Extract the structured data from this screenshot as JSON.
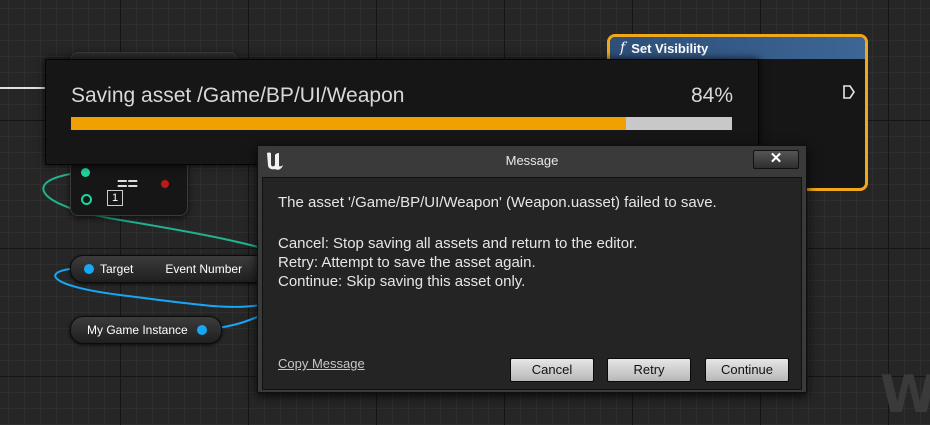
{
  "progress": {
    "label": "Saving asset /Game/BP/UI/Weapon",
    "percent_text": "84%",
    "fraction": 0.84,
    "bar_color": "#f0a000"
  },
  "nodes": {
    "set_visibility_title": "Set Visibility",
    "function_glyph": "f",
    "compare_op": "==",
    "index_value": "1",
    "target_label": "Target",
    "event_number_label": "Event Number",
    "game_instance_label": "My Game Instance"
  },
  "dialog": {
    "title": "Message",
    "close_glyph": "✕",
    "main_message": "The asset '/Game/BP/UI/Weapon' (Weapon.uasset) failed to save.",
    "options": [
      "Cancel: Stop saving all assets and return to the editor.",
      "Retry: Attempt to save the asset again.",
      "Continue: Skip saving this asset only."
    ],
    "copy_link": "Copy Message",
    "buttons": {
      "cancel": "Cancel",
      "retry": "Retry",
      "continue": "Continue"
    }
  },
  "watermark": "W",
  "colors": {
    "selection_outline": "#f0a81a",
    "object_pin": "#17a7f5",
    "bool_pin": "#1fd3a0",
    "exec_red": "#c01818"
  }
}
